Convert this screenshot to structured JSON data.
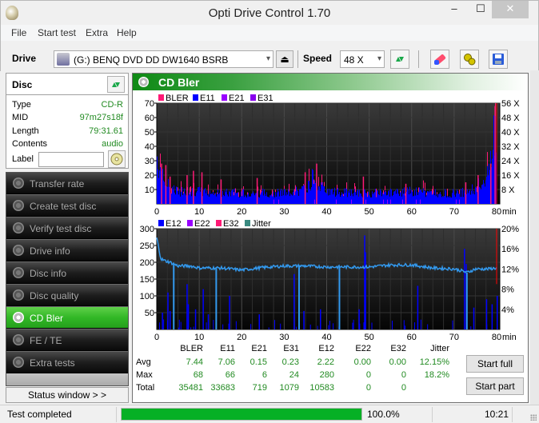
{
  "window": {
    "title": "Opti Drive Control 1.70",
    "min_label": "‒",
    "max_label": "☐",
    "close_label": "✕"
  },
  "menu": [
    "File",
    "Start test",
    "Extra",
    "Help"
  ],
  "toolbar": {
    "drive_label": "Drive",
    "drive_value": "(G:)  BENQ DVD DD DW1640 BSRB",
    "speed_label": "Speed",
    "speed_value": "48 X",
    "eject_icon": "⏏"
  },
  "disc": {
    "header": "Disc",
    "rows": [
      {
        "key": "Type",
        "value": "CD-R"
      },
      {
        "key": "MID",
        "value": "97m27s18f"
      },
      {
        "key": "Length",
        "value": "79:31.61"
      },
      {
        "key": "Contents",
        "value": "audio"
      }
    ],
    "label_key": "Label",
    "label_value": ""
  },
  "nav": [
    {
      "label": "Transfer rate",
      "active": false
    },
    {
      "label": "Create test disc",
      "active": false
    },
    {
      "label": "Verify test disc",
      "active": false
    },
    {
      "label": "Drive info",
      "active": false
    },
    {
      "label": "Disc info",
      "active": false
    },
    {
      "label": "Disc quality",
      "active": false
    },
    {
      "label": "CD Bler",
      "active": true
    },
    {
      "label": "FE / TE",
      "active": false
    },
    {
      "label": "Extra tests",
      "active": false
    }
  ],
  "status_window_label": "Status window > >",
  "panel": {
    "title": "CD Bler"
  },
  "colors": {
    "bler": "#ff1a75",
    "e11": "#0000ff",
    "e21": "#9900ff",
    "e31": "#8800ee",
    "e12": "#0000ff",
    "e22": "#9900ff",
    "e32": "#ff1a75",
    "jitter": "#3399ee",
    "speed_marker": "#ff0000",
    "accent_green": "#06b025"
  },
  "chart_data": [
    {
      "type": "bar",
      "title": "BLER / E11 / E21 / E31",
      "legend": [
        "BLER",
        "E11",
        "E21",
        "E31"
      ],
      "legend_position": "top-left",
      "xlabel": "min",
      "x_ticks": [
        0,
        10,
        20,
        30,
        40,
        50,
        60,
        70,
        80
      ],
      "xlim": [
        0,
        80
      ],
      "y_ticks": [
        10,
        20,
        30,
        40,
        50,
        60,
        70
      ],
      "ylim": [
        0,
        70
      ],
      "y2_ticks": [
        "8 X",
        "16 X",
        "24 X",
        "32 X",
        "40 X",
        "48 X",
        "56 X"
      ],
      "y2lim": [
        0,
        56
      ],
      "grid": true,
      "profile_x": [
        0,
        1,
        2,
        3,
        5,
        7,
        10,
        15,
        20,
        25,
        30,
        35,
        37,
        38,
        40,
        45,
        50,
        55,
        60,
        65,
        70,
        73,
        75,
        77,
        78,
        79,
        79.5
      ],
      "e11_profile": [
        35,
        20,
        16,
        12,
        9,
        10,
        9,
        8,
        8,
        8,
        8,
        10,
        22,
        14,
        9,
        8,
        8,
        8,
        9,
        8,
        8,
        9,
        11,
        18,
        22,
        50,
        60
      ],
      "bler_spikes": [
        [
          1,
          28
        ],
        [
          2,
          27
        ],
        [
          3,
          19
        ],
        [
          7,
          20
        ],
        [
          8.5,
          23
        ],
        [
          10.5,
          22
        ],
        [
          15,
          17
        ],
        [
          23.5,
          18
        ],
        [
          34.8,
          22
        ],
        [
          37.5,
          28
        ],
        [
          48.5,
          19
        ],
        [
          58.5,
          14
        ],
        [
          72.6,
          15
        ],
        [
          75.5,
          20
        ],
        [
          78.5,
          28
        ],
        [
          79.5,
          68
        ]
      ]
    },
    {
      "type": "line",
      "title": "E12 / E22 / E32 / Jitter",
      "legend": [
        "E12",
        "E22",
        "E32",
        "Jitter"
      ],
      "legend_position": "top-left",
      "xlabel": "min",
      "x_ticks": [
        0,
        10,
        20,
        30,
        40,
        50,
        60,
        70,
        80
      ],
      "xlim": [
        0,
        80
      ],
      "y_ticks": [
        50,
        100,
        150,
        200,
        250,
        300
      ],
      "ylim": [
        0,
        300
      ],
      "y2_ticks": [
        "4%",
        "8%",
        "12%",
        "16%",
        "20%"
      ],
      "y2lim": [
        0,
        20
      ],
      "grid": true,
      "jitter_profile_x": [
        0,
        0.5,
        1,
        2,
        3,
        5,
        8,
        10,
        15,
        20,
        25,
        30,
        35,
        40,
        45,
        50,
        55,
        60,
        65,
        70,
        72,
        73,
        75,
        78,
        80
      ],
      "jitter_profile_pct": [
        18.2,
        16,
        14,
        13.6,
        13.4,
        12.6,
        12.6,
        12.2,
        12.2,
        11.8,
        12.3,
        12.6,
        12.6,
        12.4,
        12.4,
        12.4,
        12.8,
        12.8,
        12.2,
        12,
        11.6,
        11.3,
        12,
        12,
        12.2
      ],
      "jitter_dips": [
        4,
        14,
        33.5,
        43,
        73
      ],
      "e12_spikes": [
        [
          1.2,
          50
        ],
        [
          2.5,
          110
        ],
        [
          3,
          55
        ],
        [
          7,
          135
        ],
        [
          7.3,
          75
        ],
        [
          9,
          60
        ],
        [
          10.8,
          120
        ],
        [
          12,
          45
        ],
        [
          17,
          100
        ],
        [
          24,
          45
        ],
        [
          32.2,
          165
        ],
        [
          34.5,
          55
        ],
        [
          38.4,
          60
        ],
        [
          47.5,
          60
        ],
        [
          48.8,
          280
        ],
        [
          49,
          230
        ],
        [
          61.3,
          130
        ],
        [
          72.3,
          240
        ],
        [
          72.7,
          195
        ],
        [
          74.5,
          65
        ],
        [
          77.5,
          90
        ],
        [
          78.8,
          75
        ],
        [
          80,
          100
        ]
      ]
    }
  ],
  "stats": {
    "headers": [
      "BLER",
      "E11",
      "E21",
      "E31",
      "E12",
      "E22",
      "E32",
      "Jitter"
    ],
    "rows": [
      {
        "label": "Avg",
        "values": [
          "7.44",
          "7.06",
          "0.15",
          "0.23",
          "2.22",
          "0.00",
          "0.00",
          "12.15%"
        ]
      },
      {
        "label": "Max",
        "values": [
          "68",
          "66",
          "6",
          "24",
          "280",
          "0",
          "0",
          "18.2%"
        ]
      },
      {
        "label": "Total",
        "values": [
          "35481",
          "33683",
          "719",
          "1079",
          "10583",
          "0",
          "0",
          ""
        ]
      }
    ]
  },
  "buttons": {
    "start_full": "Start full",
    "start_part": "Start part"
  },
  "statusbar": {
    "text": "Test completed",
    "progress": 100.0,
    "progress_label": "100.0%",
    "time": "10:21"
  }
}
